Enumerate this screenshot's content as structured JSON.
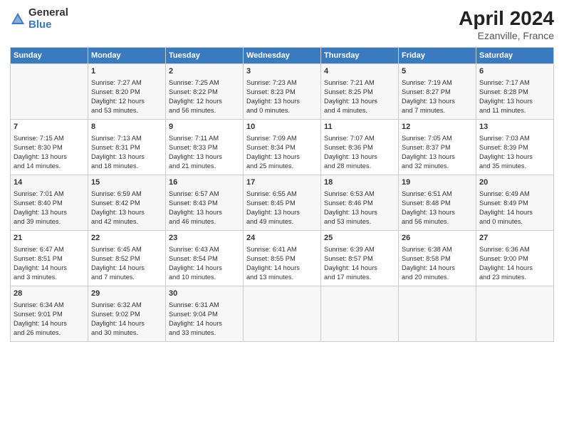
{
  "logo": {
    "general": "General",
    "blue": "Blue"
  },
  "title": {
    "month_year": "April 2024",
    "location": "Ezanville, France"
  },
  "columns": [
    "Sunday",
    "Monday",
    "Tuesday",
    "Wednesday",
    "Thursday",
    "Friday",
    "Saturday"
  ],
  "weeks": [
    [
      {
        "day": "",
        "info": ""
      },
      {
        "day": "1",
        "info": "Sunrise: 7:27 AM\nSunset: 8:20 PM\nDaylight: 12 hours\nand 53 minutes."
      },
      {
        "day": "2",
        "info": "Sunrise: 7:25 AM\nSunset: 8:22 PM\nDaylight: 12 hours\nand 56 minutes."
      },
      {
        "day": "3",
        "info": "Sunrise: 7:23 AM\nSunset: 8:23 PM\nDaylight: 13 hours\nand 0 minutes."
      },
      {
        "day": "4",
        "info": "Sunrise: 7:21 AM\nSunset: 8:25 PM\nDaylight: 13 hours\nand 4 minutes."
      },
      {
        "day": "5",
        "info": "Sunrise: 7:19 AM\nSunset: 8:27 PM\nDaylight: 13 hours\nand 7 minutes."
      },
      {
        "day": "6",
        "info": "Sunrise: 7:17 AM\nSunset: 8:28 PM\nDaylight: 13 hours\nand 11 minutes."
      }
    ],
    [
      {
        "day": "7",
        "info": "Sunrise: 7:15 AM\nSunset: 8:30 PM\nDaylight: 13 hours\nand 14 minutes."
      },
      {
        "day": "8",
        "info": "Sunrise: 7:13 AM\nSunset: 8:31 PM\nDaylight: 13 hours\nand 18 minutes."
      },
      {
        "day": "9",
        "info": "Sunrise: 7:11 AM\nSunset: 8:33 PM\nDaylight: 13 hours\nand 21 minutes."
      },
      {
        "day": "10",
        "info": "Sunrise: 7:09 AM\nSunset: 8:34 PM\nDaylight: 13 hours\nand 25 minutes."
      },
      {
        "day": "11",
        "info": "Sunrise: 7:07 AM\nSunset: 8:36 PM\nDaylight: 13 hours\nand 28 minutes."
      },
      {
        "day": "12",
        "info": "Sunrise: 7:05 AM\nSunset: 8:37 PM\nDaylight: 13 hours\nand 32 minutes."
      },
      {
        "day": "13",
        "info": "Sunrise: 7:03 AM\nSunset: 8:39 PM\nDaylight: 13 hours\nand 35 minutes."
      }
    ],
    [
      {
        "day": "14",
        "info": "Sunrise: 7:01 AM\nSunset: 8:40 PM\nDaylight: 13 hours\nand 39 minutes."
      },
      {
        "day": "15",
        "info": "Sunrise: 6:59 AM\nSunset: 8:42 PM\nDaylight: 13 hours\nand 42 minutes."
      },
      {
        "day": "16",
        "info": "Sunrise: 6:57 AM\nSunset: 8:43 PM\nDaylight: 13 hours\nand 46 minutes."
      },
      {
        "day": "17",
        "info": "Sunrise: 6:55 AM\nSunset: 8:45 PM\nDaylight: 13 hours\nand 49 minutes."
      },
      {
        "day": "18",
        "info": "Sunrise: 6:53 AM\nSunset: 8:46 PM\nDaylight: 13 hours\nand 53 minutes."
      },
      {
        "day": "19",
        "info": "Sunrise: 6:51 AM\nSunset: 8:48 PM\nDaylight: 13 hours\nand 56 minutes."
      },
      {
        "day": "20",
        "info": "Sunrise: 6:49 AM\nSunset: 8:49 PM\nDaylight: 14 hours\nand 0 minutes."
      }
    ],
    [
      {
        "day": "21",
        "info": "Sunrise: 6:47 AM\nSunset: 8:51 PM\nDaylight: 14 hours\nand 3 minutes."
      },
      {
        "day": "22",
        "info": "Sunrise: 6:45 AM\nSunset: 8:52 PM\nDaylight: 14 hours\nand 7 minutes."
      },
      {
        "day": "23",
        "info": "Sunrise: 6:43 AM\nSunset: 8:54 PM\nDaylight: 14 hours\nand 10 minutes."
      },
      {
        "day": "24",
        "info": "Sunrise: 6:41 AM\nSunset: 8:55 PM\nDaylight: 14 hours\nand 13 minutes."
      },
      {
        "day": "25",
        "info": "Sunrise: 6:39 AM\nSunset: 8:57 PM\nDaylight: 14 hours\nand 17 minutes."
      },
      {
        "day": "26",
        "info": "Sunrise: 6:38 AM\nSunset: 8:58 PM\nDaylight: 14 hours\nand 20 minutes."
      },
      {
        "day": "27",
        "info": "Sunrise: 6:36 AM\nSunset: 9:00 PM\nDaylight: 14 hours\nand 23 minutes."
      }
    ],
    [
      {
        "day": "28",
        "info": "Sunrise: 6:34 AM\nSunset: 9:01 PM\nDaylight: 14 hours\nand 26 minutes."
      },
      {
        "day": "29",
        "info": "Sunrise: 6:32 AM\nSunset: 9:02 PM\nDaylight: 14 hours\nand 30 minutes."
      },
      {
        "day": "30",
        "info": "Sunrise: 6:31 AM\nSunset: 9:04 PM\nDaylight: 14 hours\nand 33 minutes."
      },
      {
        "day": "",
        "info": ""
      },
      {
        "day": "",
        "info": ""
      },
      {
        "day": "",
        "info": ""
      },
      {
        "day": "",
        "info": ""
      }
    ]
  ]
}
